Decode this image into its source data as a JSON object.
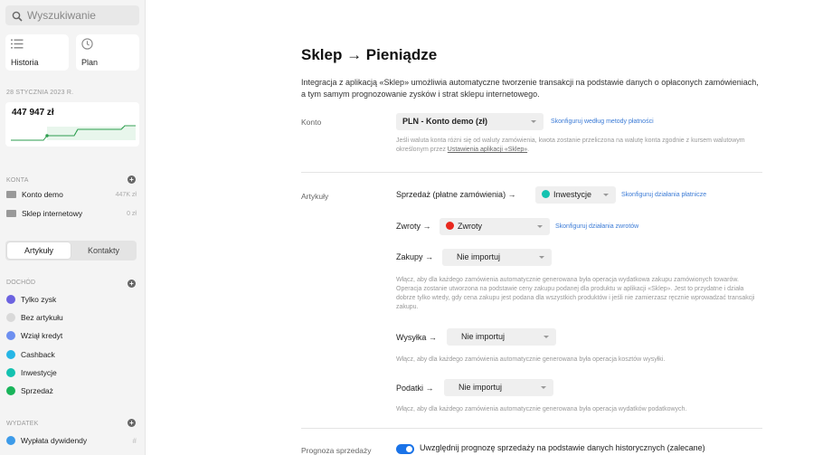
{
  "sidebar": {
    "search_placeholder": "Wyszukiwanie",
    "tiles": [
      {
        "label": "Historia",
        "icon": "list-icon"
      },
      {
        "label": "Plan",
        "icon": "clock-icon"
      }
    ],
    "date": "28 STYCZNIA 2023 R.",
    "balance": "447 947 zł",
    "accounts_header": "KONTA",
    "accounts": [
      {
        "name": "Konto demo",
        "value": "447K zł"
      },
      {
        "name": "Sklep internetowy",
        "value": "0 zł"
      }
    ],
    "tabs": {
      "active": "Artykuły",
      "inactive": "Kontakty"
    },
    "income_header": "DOCHÓD",
    "income": [
      {
        "name": "Tylko zysk",
        "color": "#6c63e0"
      },
      {
        "name": "Bez artykułu",
        "color": "#d9d9d9"
      },
      {
        "name": "Wziął kredyt",
        "color": "#6d8ff0"
      },
      {
        "name": "Cashback",
        "color": "#26b6e6"
      },
      {
        "name": "Inwestycje",
        "color": "#14c2b0"
      },
      {
        "name": "Sprzedaż",
        "color": "#19b45a"
      }
    ],
    "expense_header": "WYDATEK",
    "expense": [
      {
        "name": "Wypłata dywidendy",
        "color": "#3d9be9",
        "hash": "#"
      }
    ]
  },
  "main": {
    "title": "Sklep → Pieniądze",
    "intro": "Integracja z aplikacją «Sklep» umożliwia automatyczne tworzenie transakcji na podstawie danych o opłaconych zamówieniach, a tym samym prognozowanie zysków i strat sklepu internetowego.",
    "konto": {
      "label": "Konto",
      "value": "PLN - Konto demo (zł)",
      "link": "Skonfiguruj według metody płatności",
      "note_text": "Jeśli waluta konta różni się od waluty zamówienia, kwota zostanie przeliczona na walutę konta zgodnie z kursem walutowym określonym przez ",
      "note_link": "Ustawienia aplikacji «Sklep»",
      "note_end": "."
    },
    "artykuly": {
      "label": "Artykuły",
      "sprzedaz_label": "Sprzedaż (płatne zamówienia) →",
      "sprzedaz_value": "Inwestycje",
      "sprzedaz_color": "#14c2b0",
      "sprzedaz_link": "Skonfiguruj działania płatnicze",
      "zwroty_label": "Zwroty →",
      "zwroty_value": "Zwroty",
      "zwroty_color": "#e8281e",
      "zwroty_link": "Skonfiguruj działania zwrotów",
      "zakupy_label": "Zakupy →",
      "zakupy_value": "Nie importuj",
      "zakupy_note": "Włącz, aby dla każdego zamówienia automatycznie generowana była operacja wydatkowa zakupu zamówionych towarów. Operacja zostanie utworzona na podstawie ceny zakupu podanej dla produktu w aplikacji «Sklep». Jest to przydatne i działa dobrze tylko wtedy, gdy cena zakupu jest podana dla wszystkich produktów i jeśli nie zamierzasz ręcznie wprowadzać transakcji zakupu.",
      "wysylka_label": "Wysyłka →",
      "wysylka_value": "Nie importuj",
      "wysylka_note": "Włącz, aby dla każdego zamówienia automatycznie generowana była operacja kosztów wysyłki.",
      "podatki_label": "Podatki →",
      "podatki_value": "Nie importuj",
      "podatki_note": "Włącz, aby dla każdego zamówienia automatycznie generowana była operacja wydatków podatkowych."
    },
    "prognoza": {
      "label": "Prognoza sprzedaży",
      "toggle_on": true,
      "text": "Uwzględnij prognozę sprzedaży na podstawie danych historycznych (zalecane)"
    }
  }
}
